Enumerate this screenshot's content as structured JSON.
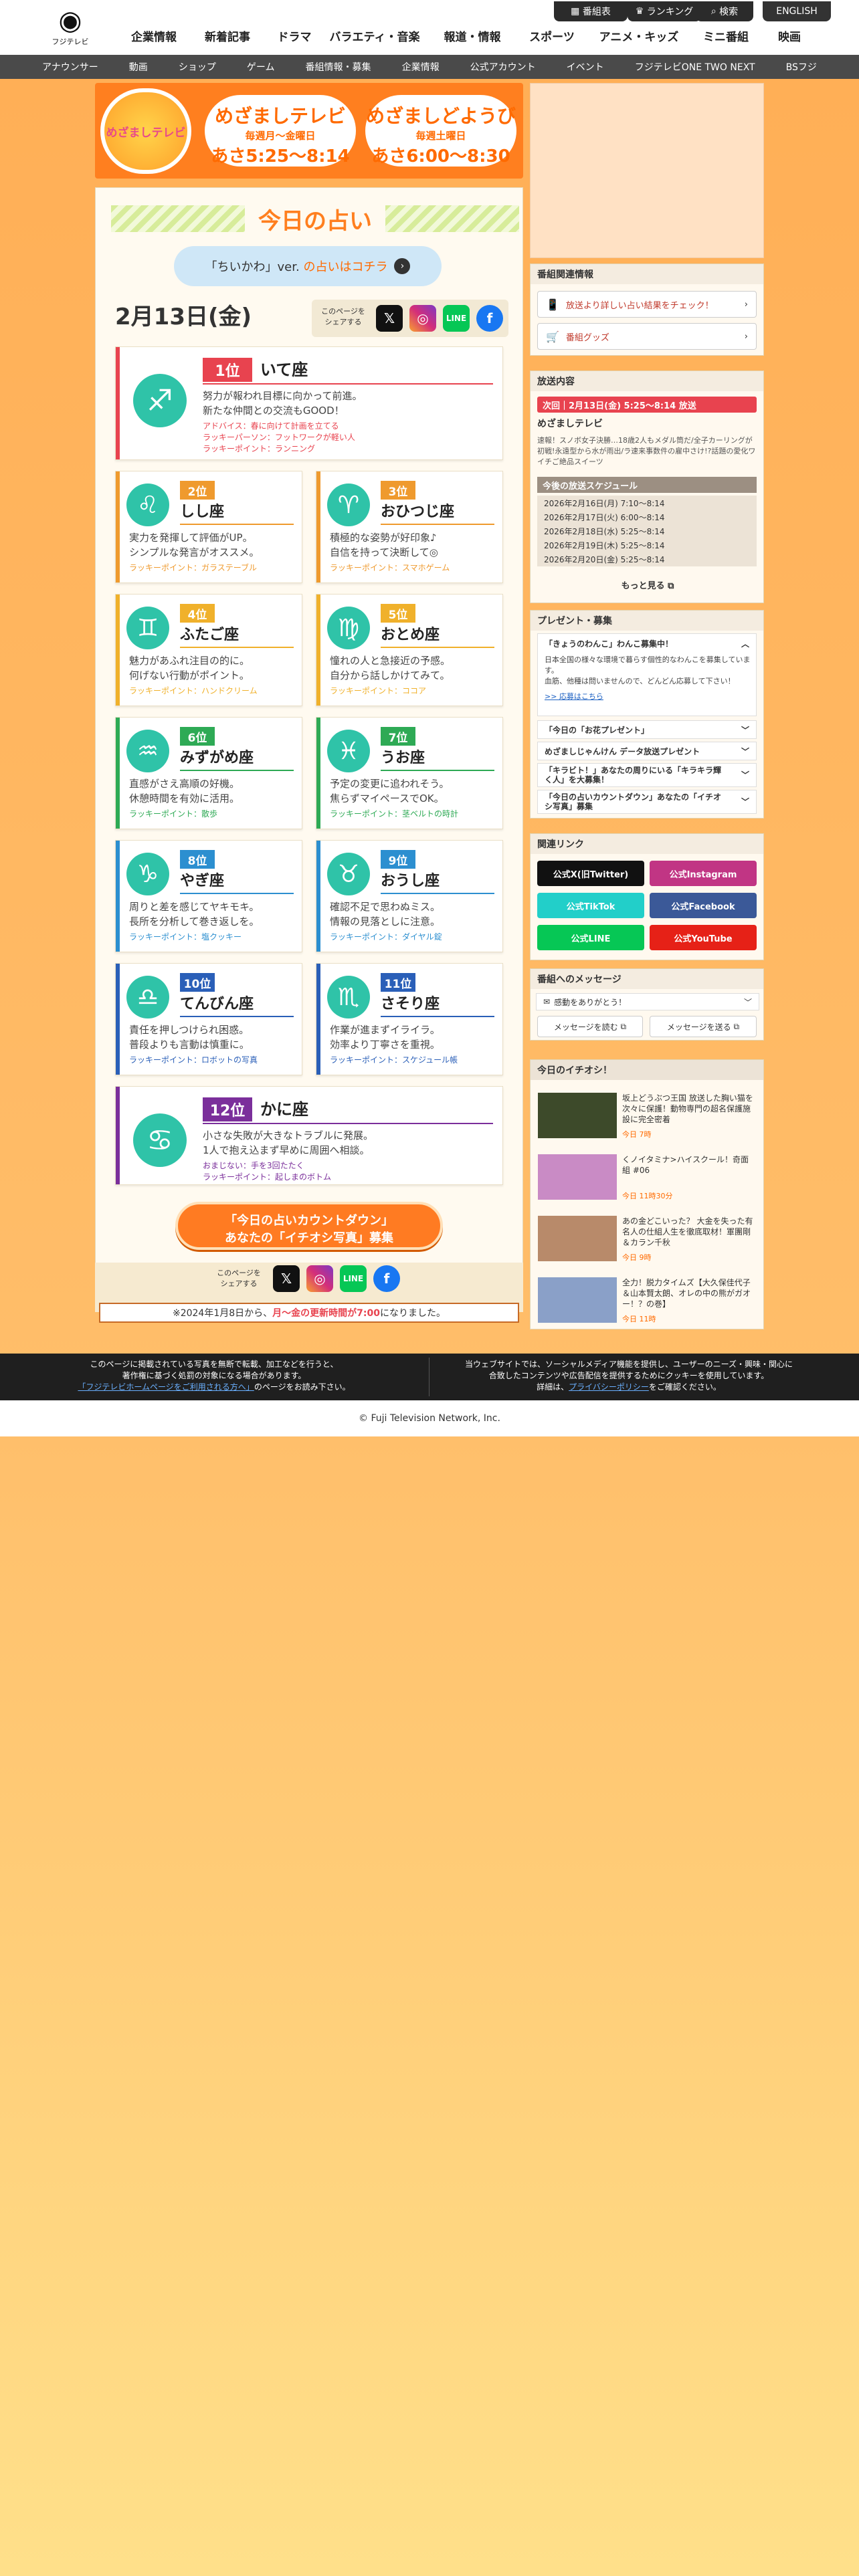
{
  "header": {
    "logo_text": "フジテレビ",
    "util": [
      "番組表",
      "ランキング",
      "検索"
    ],
    "english": "ENGLISH",
    "nav": [
      "企業情報",
      "新着記事",
      "ドラマ",
      "バラエティ・音楽",
      "報道・情報",
      "スポーツ",
      "アニメ・キッズ",
      "ミニ番組",
      "映画"
    ]
  },
  "subnav": [
    "アナウンサー",
    "動画",
    "ショップ",
    "ゲーム",
    "番組情報・募集",
    "企業情報",
    "公式アカウント",
    "イベント",
    "フジテレビONE TWO NEXT",
    "BSフジ"
  ],
  "banner": {
    "logo": "めざましテレビ",
    "weekday": {
      "title": "めざましテレビ",
      "sub": "毎週月～金曜日",
      "time": "あさ5:25〜8:14"
    },
    "saturday": {
      "title": "めざましどようび",
      "sub": "毎週土曜日",
      "time": "あさ6:00〜8:30"
    }
  },
  "uranai": {
    "title": "今日の占い",
    "chiikawa_a": "「ちいかわ」ver.",
    "chiikawa_b": "の占いはコチラ",
    "date": "2月13日(金)",
    "share_label": "このページを\nシェアする",
    "signs": [
      {
        "rank": "1位",
        "name": "いて座",
        "symbol": "♐",
        "color": "#e8434f",
        "desc": [
          "努力が報われ目標に向かって前進。",
          "新たな仲間との交流もGOOD！"
        ],
        "lucky": [
          "アドバイス：春に向けて計画を立てる",
          "ラッキーパーソン：フットワークが軽い人",
          "ラッキーポイント：ランニング"
        ]
      },
      {
        "rank": "2位",
        "name": "しし座",
        "symbol": "♌",
        "color": "#ef9a2e",
        "desc": [
          "実力を発揮して評価がUP。",
          "シンプルな発言がオススメ。"
        ],
        "lucky": [
          "ラッキーポイント：ガラステーブル"
        ]
      },
      {
        "rank": "3位",
        "name": "おひつじ座",
        "symbol": "♈",
        "color": "#ef9a2e",
        "desc": [
          "積極的な姿勢が好印象♪",
          "自信を持って決断して◎"
        ],
        "lucky": [
          "ラッキーポイント：スマホゲーム"
        ]
      },
      {
        "rank": "4位",
        "name": "ふたご座",
        "symbol": "♊",
        "color": "#f0b12b",
        "desc": [
          "魅力があふれ注目の的に。",
          "何げない行動がポイント。"
        ],
        "lucky": [
          "ラッキーポイント：ハンドクリーム"
        ]
      },
      {
        "rank": "5位",
        "name": "おとめ座",
        "symbol": "♍",
        "color": "#f0b12b",
        "desc": [
          "憧れの人と急接近の予感。",
          "自分から話しかけてみて。"
        ],
        "lucky": [
          "ラッキーポイント：ココア"
        ]
      },
      {
        "rank": "6位",
        "name": "みずがめ座",
        "symbol": "♒",
        "color": "#2eaa55",
        "desc": [
          "直感がさえ高順の好機。",
          "休憩時間を有効に活用。"
        ],
        "lucky": [
          "ラッキーポイント：散歩"
        ]
      },
      {
        "rank": "7位",
        "name": "うお座",
        "symbol": "♓",
        "color": "#2eaa55",
        "desc": [
          "予定の変更に追われそう。",
          "焦らずマイペースでOK。"
        ],
        "lucky": [
          "ラッキーポイント：茎ベルトの時計"
        ]
      },
      {
        "rank": "8位",
        "name": "やぎ座",
        "symbol": "♑",
        "color": "#2c8fd0",
        "desc": [
          "周りと差を感じてヤキモキ。",
          "長所を分析して巻き返しを。"
        ],
        "lucky": [
          "ラッキーポイント：塩クッキー"
        ]
      },
      {
        "rank": "9位",
        "name": "おうし座",
        "symbol": "♉",
        "color": "#2c8fd0",
        "desc": [
          "確認不足で思わぬミス。",
          "情報の見落としに注意。"
        ],
        "lucky": [
          "ラッキーポイント：ダイヤル錠"
        ]
      },
      {
        "rank": "10位",
        "name": "てんびん座",
        "symbol": "♎",
        "color": "#2a5fb8",
        "desc": [
          "責任を押しつけられ困惑。",
          "普段よりも言動は慎重に。"
        ],
        "lucky": [
          "ラッキーポイント：ロボットの写真"
        ]
      },
      {
        "rank": "11位",
        "name": "さそり座",
        "symbol": "♏",
        "color": "#2a5fb8",
        "desc": [
          "作業が進まずイライラ。",
          "効率より丁寧さを重視。"
        ],
        "lucky": [
          "ラッキーポイント：スケジュール帳"
        ]
      },
      {
        "rank": "12位",
        "name": "かに座",
        "symbol": "♋",
        "color": "#7b2f9b",
        "desc": [
          "小さな失敗が大きなトラブルに発展。",
          "1人で抱え込まず早めに周囲へ相談。"
        ],
        "lucky": [
          "おまじない：手を3回たたく",
          "ラッキーポイント：起しまのボトム"
        ]
      }
    ],
    "countdown": [
      "「今日の占いカウントダウン」",
      "あなたの「イチオシ写真」募集"
    ],
    "notice_a": "※2024年1月8日から、",
    "notice_b": "月～金の更新時間が7:00",
    "notice_c": "になりました。"
  },
  "sidebar": {
    "related_title": "番組関連情報",
    "related_buttons": [
      "放送より詳しい占い結果をチェック！",
      "番組グッズ"
    ],
    "broadcast_title": "放送内容",
    "next_label": "次回｜2月13日(金) 5:25〜8:14 放送",
    "show_name": "めざましテレビ",
    "summary": "速報！スノボ女子決勝…18歳2人もメダル筒だ/全子カーリングが初戦!永遠型から水が雨出/ラ速来事数件の雇中さけ!?話題の愛化ワイチご絶品スイーツ",
    "schedule_title": "今後の放送スケジュール",
    "schedule": [
      "2026年2月16日(月) 7:10〜8:14",
      "2026年2月17日(火) 6:00〜8:14",
      "2026年2月18日(水) 5:25〜8:14",
      "2026年2月19日(木) 5:25〜8:14",
      "2026年2月20日(金) 5:25〜8:14"
    ],
    "more": "もっと見る",
    "present_title": "プレゼント・募集",
    "present_open": "「きょうのわんこ」わんこ募集中！",
    "present_body": "日本全国の様々な環境で暮らす個性的なわんこを募集しています。\n血筋、他種は問いませんので、どんどん応募して下さい！",
    "present_link": ">> 応募はこちら",
    "present_items": [
      "「今日の「お花プレゼント」",
      "めざましじゃんけん データ放送プレゼント",
      "「キラビト！」あなたの周りにいる「キラキラ輝く人」を大募集！",
      "「今日の占いカウントダウン」あなたの「イチオシ写真」募集"
    ],
    "links_title": "関連リンク",
    "links": [
      {
        "label": "公式X(旧Twitter)",
        "color": "#111111"
      },
      {
        "label": "公式Instagram",
        "color": "#c13584"
      },
      {
        "label": "公式TikTok",
        "color": "#22cfc9"
      },
      {
        "label": "公式Facebook",
        "color": "#3b5998"
      },
      {
        "label": "公式LINE",
        "color": "#06c755"
      },
      {
        "label": "公式YouTube",
        "color": "#e62117"
      }
    ],
    "message_title": "番組へのメッセージ",
    "message_select": "感動をありがとう！",
    "message_read": "メッセージを読む",
    "message_send": "メッセージを送る",
    "pick_title": "今日のイチオシ！",
    "news": [
      {
        "title": "坂上どうぶつ王国 放送した胸い猫を次々に保護！動物専門の超名保護施設に完全密着",
        "date": "今日 7時"
      },
      {
        "title": "くノイタミナ>ハイスクール！奇面組 #06",
        "date": "今日 11時30分"
      },
      {
        "title": "あの金どこいった？ 大金を失った有名人の仕組人生を徹底取材！軍團剛＆カラン千秋",
        "date": "今日 9時"
      },
      {
        "title": "全力！脱力タイムズ【大久保佳代子＆山本賢太朗、オレの中の熊がガオー！？の巻】",
        "date": "今日 11時"
      }
    ]
  },
  "footer": {
    "left": [
      "このページに掲載されている写真を無断で転載、加工などを行うと、",
      "著作権に基づく処罰の対象になる場合があります。"
    ],
    "left_link": "「フジテレビホームページをご利用される方へ」",
    "left_tail": "のページをお読み下さい。",
    "right": [
      "当ウェブサイトでは、ソーシャルメディア機能を提供し、ユーザーのニーズ・興味・関心に",
      "合致したコンテンツや広告配信を提供するためにクッキーを使用しています。"
    ],
    "right_pre": "詳細は、",
    "right_link": "プライバシーポリシー",
    "right_tail": "をご確認ください。",
    "copyright": "© Fuji Television Network, Inc."
  }
}
